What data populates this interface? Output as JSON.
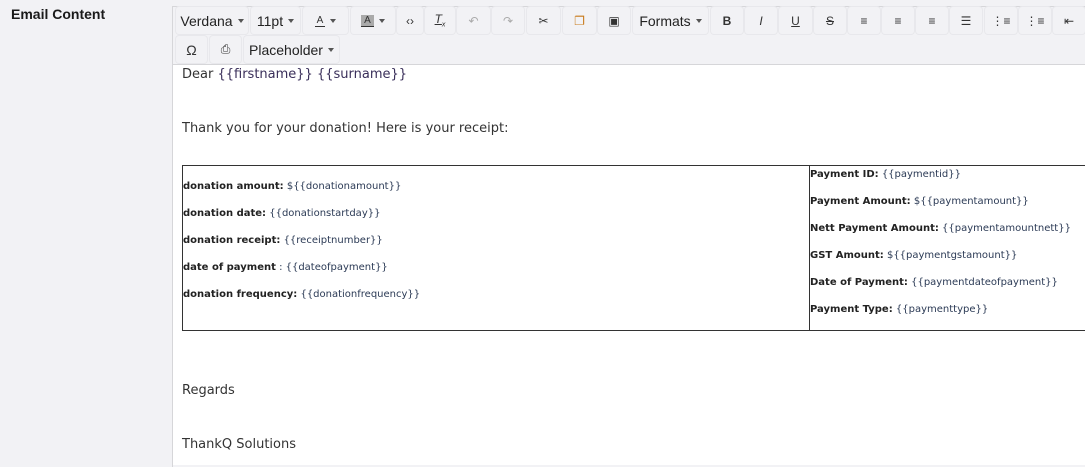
{
  "field_label": "Email Content",
  "toolbar": {
    "font_family": "Verdana",
    "font_size": "11pt",
    "text_color_label": "A",
    "bg_color_label": "A",
    "formats": "Formats",
    "placeholder": "Placeholder",
    "icons": [
      "text-color-icon",
      "background-color-icon",
      "source-code-icon",
      "clear-formatting-icon",
      "undo-icon",
      "redo-icon",
      "cut-icon",
      "copy-icon",
      "paste-icon",
      "bold-icon",
      "italic-icon",
      "underline-icon",
      "strikethrough-icon",
      "align-left-icon",
      "align-center-icon",
      "align-right-icon",
      "justify-icon",
      "bullet-list-icon",
      "numbered-list-icon",
      "outdent-icon",
      "special-character-icon",
      "print-icon"
    ]
  },
  "body": {
    "greeting": "Dear",
    "firstname": "{{firstname}}",
    "surname": "{{surname}}",
    "intro": "Thank you for your donation! Here is your receipt:",
    "regards": "Regards",
    "signature": "ThankQ Solutions"
  },
  "receipt_left": [
    {
      "label": "donation amount:",
      "value": "${{donationamount}}"
    },
    {
      "label": "donation date:",
      "value": "{{donationstartday}}"
    },
    {
      "label": "donation receipt:",
      "value": "{{receiptnumber}}"
    },
    {
      "label": "date of payment",
      "value": ": {{dateofpayment}}"
    },
    {
      "label": "donation frequency:",
      "value": "{{donationfrequency}}"
    }
  ],
  "receipt_right": [
    {
      "label": "Payment ID:",
      "value": "{{paymentid}}"
    },
    {
      "label": "Payment Amount:",
      "value": "${{paymentamount}}"
    },
    {
      "label": "Nett Payment Amount:",
      "value": "{{paymentamountnett}}"
    },
    {
      "label": "GST Amount:",
      "value": "${{paymentgstamount}}"
    },
    {
      "label": "Date of Payment:",
      "value": "{{paymentdateofpayment}}"
    },
    {
      "label": "Payment Type:",
      "value": "{{paymenttype}}"
    }
  ]
}
